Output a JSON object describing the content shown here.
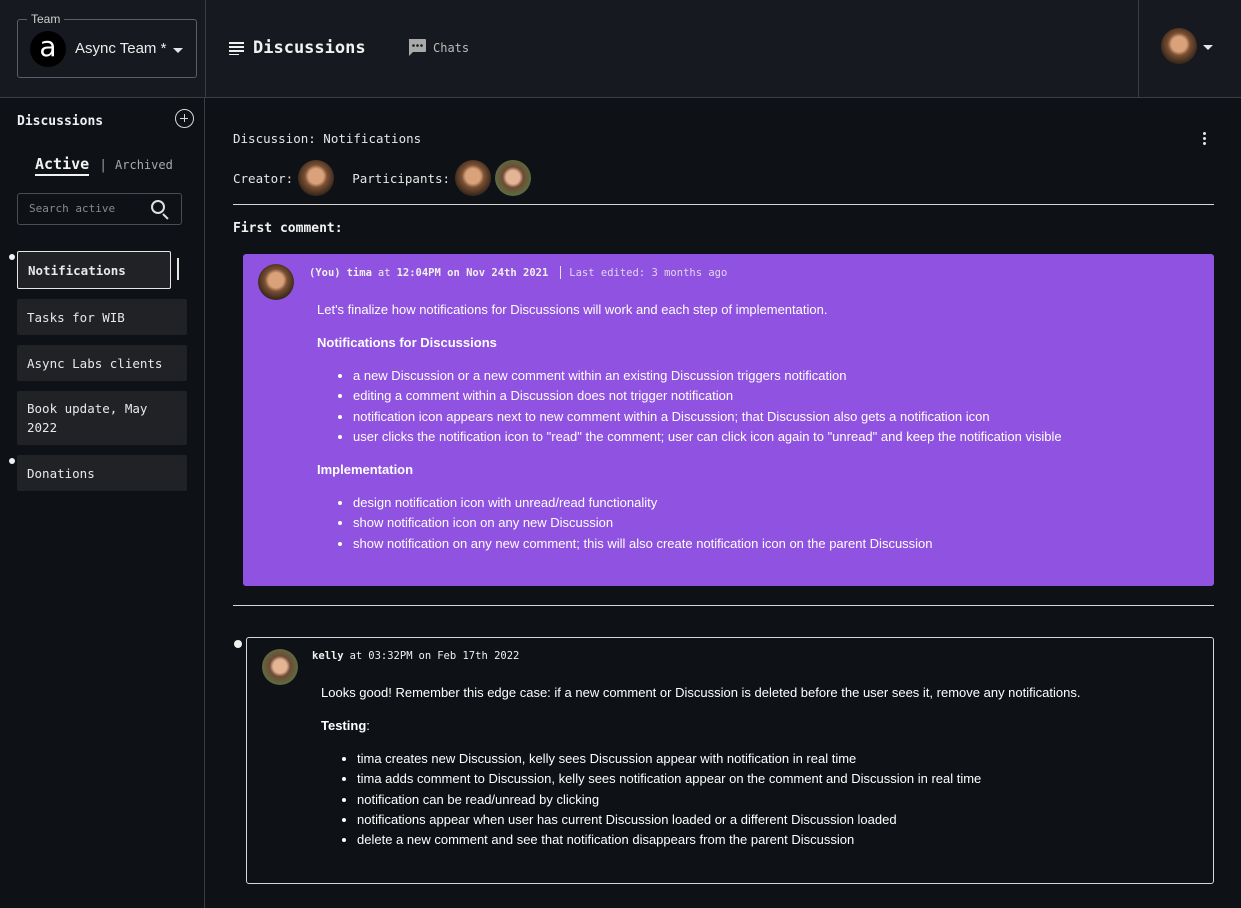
{
  "team": {
    "legend": "Team",
    "logo_letter": "a",
    "name": "Async Team *"
  },
  "nav": {
    "discussions_label": "Discussions",
    "chats_label": "Chats"
  },
  "sidebar": {
    "title": "Discussions",
    "tab_active": "Active",
    "tab_separator": "|",
    "tab_archived": "Archived",
    "search_placeholder": "Search active",
    "items": [
      {
        "label": "Notifications",
        "selected": true,
        "unread": true
      },
      {
        "label": "Tasks for WIB",
        "selected": false,
        "unread": false
      },
      {
        "label": "Async Labs clients",
        "selected": false,
        "unread": false
      },
      {
        "label": "Book update, May 2022",
        "selected": false,
        "unread": false
      },
      {
        "label": "Donations",
        "selected": false,
        "unread": true
      }
    ]
  },
  "discussion": {
    "title": "Discussion: Notifications",
    "creator_label": "Creator:",
    "participants_label": "Participants:",
    "first_comment_label": "First comment:"
  },
  "comments": [
    {
      "prefix": "(You)",
      "author": "tima",
      "at": "at",
      "time": "12:04PM on Nov 24th 2021",
      "edited": "Last edited: 3 months ago",
      "intro": "Let's finalize how notifications for Discussions will work and each step of implementation.",
      "heading1": "Notifications for Discussions",
      "list1": [
        "a new Discussion or a new comment within an existing Discussion triggers notification",
        "editing a comment within a Discussion does not trigger notification",
        "notification icon appears next to new comment within a Discussion; that Discussion also gets a notification icon",
        "user clicks the notification icon to \"read\" the comment; user can click icon again to \"unread\" and keep the notification visible"
      ],
      "heading2": "Implementation",
      "list2": [
        "design notification icon with unread/read functionality",
        "show notification icon on any new Discussion",
        "show notification on any new comment; this will also create notification icon on the parent Discussion"
      ]
    },
    {
      "author": "kelly",
      "at": "at",
      "time_a": "03:32PM",
      "time_on": "on",
      "time_b": "Feb 17th 2022",
      "intro": "Looks good! Remember this edge case: if a new comment or Discussion is deleted before the user sees it, remove any notifications.",
      "heading": "Testing",
      "heading_suffix": ":",
      "list": [
        "tima creates new Discussion, kelly sees Discussion appear with notification in real time",
        "tima adds comment to Discussion, kelly sees notification appear on the comment and Discussion in real time",
        "notification can be read/unread by clicking",
        "notifications appear when user has current Discussion loaded or a different Discussion loaded",
        "delete a new comment and see that notification disappears from the parent Discussion"
      ]
    }
  ],
  "colors": {
    "background": "#0e1116",
    "topbar": "#16191f",
    "first_comment_card": "#9052e0",
    "sidebar_item": "#202226"
  },
  "icons": [
    "team-logo-icon",
    "caret-down-icon",
    "discussions-list-icon",
    "chat-bubble-icon",
    "add-circle-icon",
    "search-icon",
    "more-vertical-icon"
  ]
}
